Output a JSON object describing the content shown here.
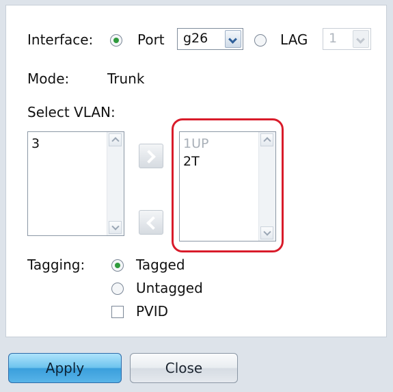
{
  "interface": {
    "label": "Interface:",
    "port_label": "Port",
    "port_value": "g26",
    "lag_label": "LAG",
    "lag_value": "1"
  },
  "mode": {
    "label": "Mode:",
    "value": "Trunk"
  },
  "select_vlan": {
    "label": "Select VLAN:",
    "available": [
      "3"
    ],
    "selected": [
      "1UP",
      "2T"
    ]
  },
  "tagging": {
    "label": "Tagging:",
    "tagged": "Tagged",
    "untagged": "Untagged",
    "pvid": "PVID"
  },
  "buttons": {
    "apply": "Apply",
    "close": "Close"
  },
  "colors": {
    "highlight": "#d91b2a",
    "radio_checked": "#2f9a3c",
    "apply": "#58b4e8"
  }
}
